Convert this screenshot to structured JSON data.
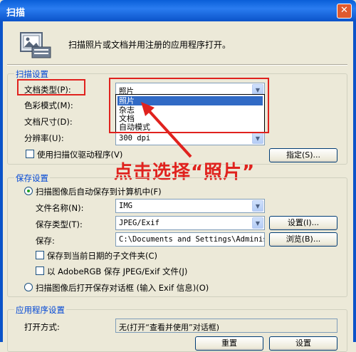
{
  "window": {
    "title": "扫描",
    "close_glyph": "✕"
  },
  "intro_text": "扫描照片或文档并用注册的应用程序打开。",
  "scan_settings": {
    "title": "扫描设置",
    "doc_type_label": "文档类型(P):",
    "doc_type_value": "照片",
    "dropdown_options": [
      "照片",
      "杂志",
      "文档",
      "自动模式"
    ],
    "color_mode_label": "色彩模式(M):",
    "doc_size_label": "文档尺寸(D):",
    "resolution_label": "分辨率(U):",
    "resolution_value": "300 dpi",
    "use_driver_label": "使用扫描仪驱动程序(V)",
    "specify_button": "指定(S)..."
  },
  "callout_text": "点击选择“照片”",
  "save_settings": {
    "title": "保存设置",
    "auto_save_label": "扫描图像后自动保存到计算机中(F)",
    "file_name_label": "文件名称(N):",
    "file_name_value": "IMG",
    "save_type_label": "保存类型(T):",
    "save_type_value": "JPEG/Exif",
    "settings_button": "设置(I)...",
    "save_in_label": "保存:",
    "save_in_value": "C:\\Documents and Settings\\Administ",
    "browse_button": "浏览(B)...",
    "subfolder_label": "保存到当前日期的子文件夹(C)",
    "adobergb_label": "以 AdobeRGB 保存 JPEG/Exif 文件(J)",
    "open_dialog_label": "扫描图像后打开保存对话框 (输入 Exif 信息)(O)"
  },
  "app_settings": {
    "title": "应用程序设置",
    "open_with_label": "打开方式:",
    "open_with_value": "无(打开“查看并使用”对话框)",
    "reset_button": "重置",
    "settings_button": "设置"
  },
  "colors": {
    "title_bar": "#0b53c9",
    "highlight": "#316ac5",
    "annotation_red": "#e0221e",
    "group_title": "#0046d5"
  },
  "icons": [
    "close-icon",
    "scan-photo-icon",
    "chevron-down-icon",
    "annotation-arrow-icon"
  ]
}
